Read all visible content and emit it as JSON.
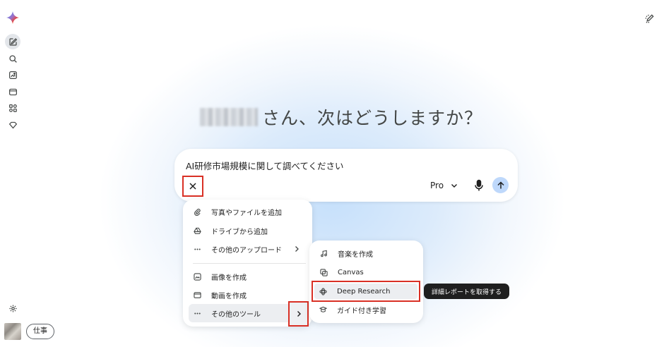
{
  "greeting": {
    "suffix": "さん、次はどうしますか？"
  },
  "prompt": {
    "text": "AI研修市場規模に関して調べてください",
    "model": "Pro"
  },
  "sidebar": {
    "work_label": "仕事"
  },
  "tools_menu": {
    "items": [
      {
        "label": "写真やファイルを追加",
        "icon": "paperclip-icon"
      },
      {
        "label": "ドライブから追加",
        "icon": "drive-icon"
      },
      {
        "label": "その他のアップロード",
        "icon": "more-horiz-icon"
      },
      {
        "label": "画像を作成",
        "icon": "image-icon"
      },
      {
        "label": "動画を作成",
        "icon": "video-icon"
      },
      {
        "label": "その他のツール",
        "icon": "more-horiz-icon"
      }
    ]
  },
  "sub_menu": {
    "items": [
      {
        "label": "音楽を作成",
        "icon": "music-icon"
      },
      {
        "label": "Canvas",
        "icon": "canvas-icon"
      },
      {
        "label": "Deep Research",
        "icon": "deep-research-icon"
      },
      {
        "label": "ガイド付き学習",
        "icon": "guided-learning-icon"
      }
    ],
    "tooltip": "詳細レポートを取得する"
  },
  "colors": {
    "highlight_border": "#d93025",
    "send_button": "#bed8fb",
    "tooltip_bg": "#1f1f1f"
  }
}
